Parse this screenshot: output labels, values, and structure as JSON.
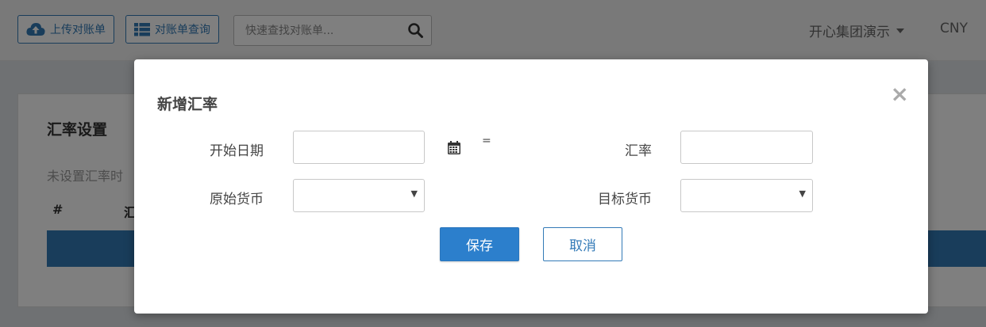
{
  "topbar": {
    "upload_label": "上传对账单",
    "query_label": "对账单查询",
    "search_placeholder": "快速查找对账单...",
    "org_name": "开心集团演示",
    "currency": "CNY"
  },
  "panel": {
    "title": "汇率设置",
    "note": "未设置汇率时",
    "col_hash": "#",
    "col_rate": "汇"
  },
  "modal": {
    "title": "新增汇率",
    "close_symbol": "×",
    "start_date_label": "开始日期",
    "equals": "=",
    "rate_label": "汇率",
    "source_currency_label": "原始货币",
    "target_currency_label": "目标货币",
    "save_label": "保存",
    "cancel_label": "取消"
  },
  "icons": {
    "upload": "cloud-upload-icon",
    "query": "table-list-icon",
    "search": "search-icon",
    "calendar": "calendar-icon",
    "close": "close-icon"
  },
  "colors": {
    "primary": "#337ab7",
    "save_button": "#2c7fcc",
    "overlay": "rgba(0,0,0,0.5)"
  }
}
